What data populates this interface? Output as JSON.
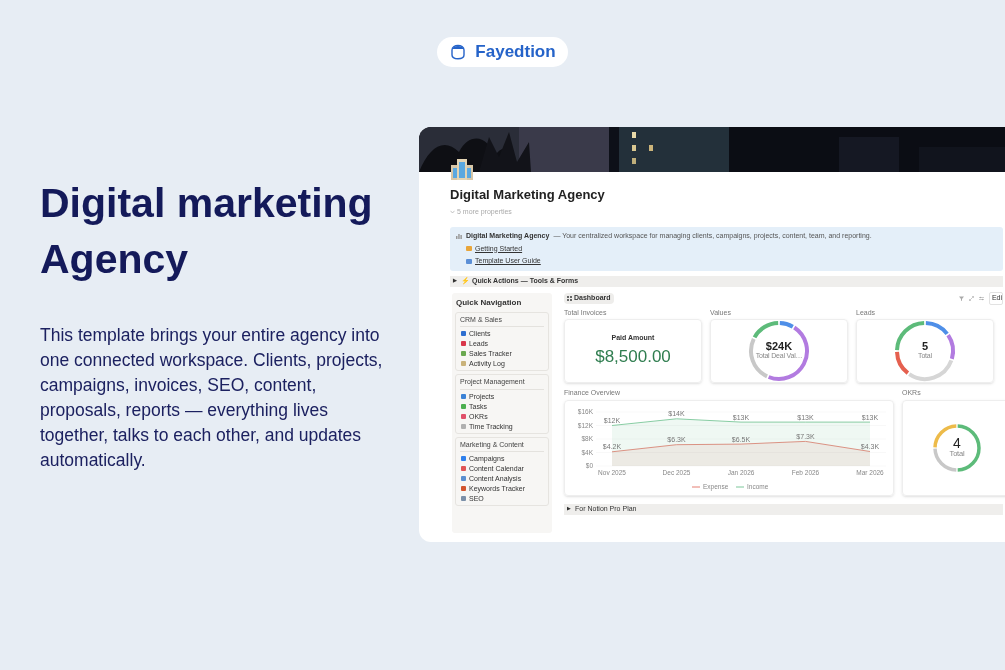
{
  "brand": {
    "name": "Fayedtion"
  },
  "hero": {
    "title": "Digital marketing Agency",
    "description": "This template brings your entire agency into one connected workspace. Clients, projects, campaigns, invoices, SEO, content, proposals, reports — everything lives together, talks to each other, and updates automatically."
  },
  "page": {
    "title": "Digital Marketing Agency",
    "properties_toggle": "5 more properties",
    "callout": {
      "title": "Digital Marketing Agency",
      "text": "— Your centralized workspace for managing clients, campaigns, projects, content, team, and reporting.",
      "links": [
        {
          "label": "Getting Started",
          "color": "#e8a53a"
        },
        {
          "label": "Template User Guide",
          "color": "#5b8fd6"
        }
      ]
    },
    "quick_actions": {
      "arrow": "▶",
      "label": "⚡ Quick Actions — Tools & Forms"
    },
    "navigation": {
      "title": "Quick Navigation",
      "groups": [
        {
          "title": "CRM & Sales",
          "items": [
            {
              "label": "Clients",
              "color": "#2f6fd0"
            },
            {
              "label": "Leads",
              "color": "#d9364a"
            },
            {
              "label": "Sales Tracker",
              "color": "#6aa84f"
            },
            {
              "label": "Activity Log",
              "color": "#c9b27a"
            }
          ]
        },
        {
          "title": "Project Management",
          "items": [
            {
              "label": "Projects",
              "color": "#3b82d6"
            },
            {
              "label": "Tasks",
              "color": "#4caf50"
            },
            {
              "label": "OKRs",
              "color": "#e0506a"
            },
            {
              "label": "Time Tracking",
              "color": "#b0b0b0"
            }
          ]
        },
        {
          "title": "Marketing & Content",
          "items": [
            {
              "label": "Campaigns",
              "color": "#2f80ed"
            },
            {
              "label": "Content Calendar",
              "color": "#e05555"
            },
            {
              "label": "Content Analysis",
              "color": "#5a8fd0"
            },
            {
              "label": "Keywords Tracker",
              "color": "#d2552f"
            },
            {
              "label": "SEO",
              "color": "#7a8fa8"
            }
          ]
        }
      ]
    },
    "dashboard": {
      "view_tab": "Dashboard",
      "edit_button": "Edi",
      "total_invoices": {
        "label": "Total Invoices",
        "caption": "Paid Amount",
        "value": "$8,500.00"
      },
      "values": {
        "label": "Values",
        "center_value": "$24K",
        "center_label": "Total Deal Val…"
      },
      "leads": {
        "label": "Leads",
        "center_value": "5",
        "center_label": "Total"
      },
      "finance": {
        "label": "Finance Overview",
        "chart_data": {
          "type": "area",
          "categories": [
            "Nov 2025",
            "Dec 2025",
            "Jan 2026",
            "Feb 2026",
            "Mar 2026"
          ],
          "series": [
            {
              "name": "Expense",
              "color": "#e57f73",
              "values": [
                4200,
                6300,
                6500,
                7300,
                4300
              ]
            },
            {
              "name": "Income",
              "color": "#7cc79a",
              "values": [
                12000,
                14000,
                13000,
                13000,
                13000
              ]
            }
          ],
          "ylim": [
            0,
            16000
          ],
          "yticks": [
            {
              "value": 0,
              "label": "$0"
            },
            {
              "value": 4000,
              "label": "$4K"
            },
            {
              "value": 8000,
              "label": "$8K"
            },
            {
              "value": 12000,
              "label": "$12K"
            },
            {
              "value": 16000,
              "label": "$16K"
            }
          ],
          "value_labels": [
            [
              "$4.2K",
              "$6.3K",
              "$6.5K",
              "$7.3K",
              "$4.3K"
            ],
            [
              "$12K",
              "$14K",
              "$13K",
              "$13K",
              "$13K"
            ]
          ],
          "legend": true
        }
      },
      "okrs": {
        "label": "OKRs",
        "center_value": "4",
        "center_label": "Total"
      }
    },
    "pro_plan": {
      "arrow": "▶",
      "label": "For Notion Pro Plan"
    }
  }
}
